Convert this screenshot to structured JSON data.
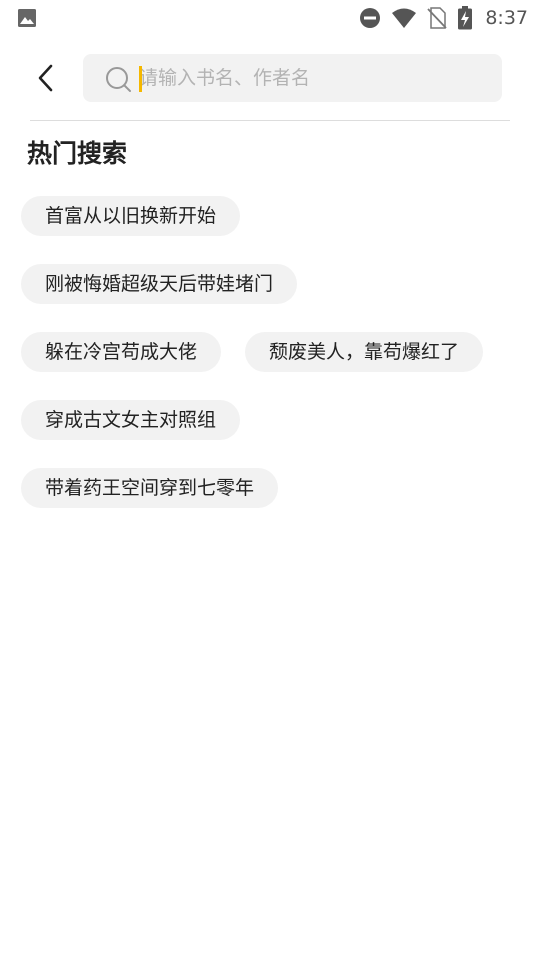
{
  "status_bar": {
    "time": "8:37",
    "icons": [
      "image-icon",
      "do-not-disturb-icon",
      "wifi-icon",
      "no-sim-icon",
      "battery-charging-icon"
    ]
  },
  "search": {
    "placeholder": "请输入书名、作者名",
    "value": "",
    "accent_color": "#f5b800"
  },
  "hot_search": {
    "title": "热门搜索",
    "tags": [
      "首富从以旧换新开始",
      "刚被悔婚超级天后带娃堵门",
      "躲在冷宫苟成大佬",
      "颓废美人，靠苟爆红了",
      "穿成古文女主对照组",
      "带着药王空间穿到七零年"
    ]
  }
}
